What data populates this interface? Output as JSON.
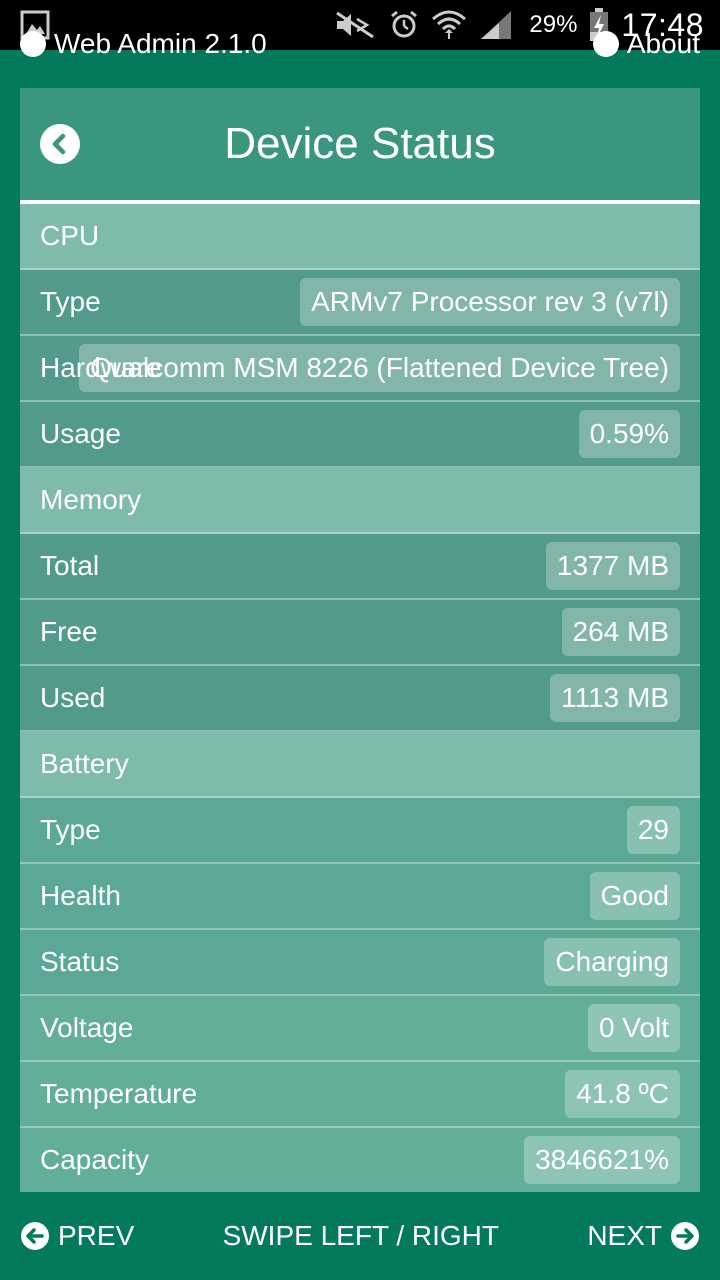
{
  "statusbar": {
    "battery_pct": "29%",
    "time": "17:48",
    "icons": [
      "gallery-icon",
      "mute-icon",
      "alarm-icon",
      "wifi-icon",
      "signal-icon",
      "battery-charging-icon"
    ]
  },
  "app_header": {
    "left_label": "Web Admin 2.1.0",
    "right_label": "About"
  },
  "panel": {
    "title": "Device Status",
    "rows": [
      {
        "kind": "section",
        "label": "CPU"
      },
      {
        "kind": "item",
        "label": "Type",
        "value": "ARMv7 Processor rev 3 (v7l)"
      },
      {
        "kind": "item",
        "label": "Hardware",
        "value": "Qualcomm MSM 8226 (Flattened Device Tree)"
      },
      {
        "kind": "item",
        "label": "Usage",
        "value": "0.59%"
      },
      {
        "kind": "section",
        "label": "Memory"
      },
      {
        "kind": "item",
        "label": "Total",
        "value": "1377 MB"
      },
      {
        "kind": "item",
        "label": "Free",
        "value": "264 MB"
      },
      {
        "kind": "item",
        "label": "Used",
        "value": "1113 MB"
      },
      {
        "kind": "section",
        "label": "Battery"
      },
      {
        "kind": "item",
        "label": "Type",
        "value": "29"
      },
      {
        "kind": "item",
        "label": "Health",
        "value": "Good"
      },
      {
        "kind": "item",
        "label": "Status",
        "value": "Charging"
      },
      {
        "kind": "item",
        "label": "Voltage",
        "value": "0 Volt"
      },
      {
        "kind": "item",
        "label": "Temperature",
        "value": "41.8 ºC"
      },
      {
        "kind": "item",
        "label": "Capacity",
        "value": "3846621%"
      }
    ]
  },
  "bottom_nav": {
    "prev_label": "PREV",
    "hint": "SWIPE LEFT / RIGHT",
    "next_label": "NEXT"
  },
  "colors": {
    "background": "#037a5c",
    "panel_header": "#3b9680",
    "panel_body": "#5aa895"
  }
}
